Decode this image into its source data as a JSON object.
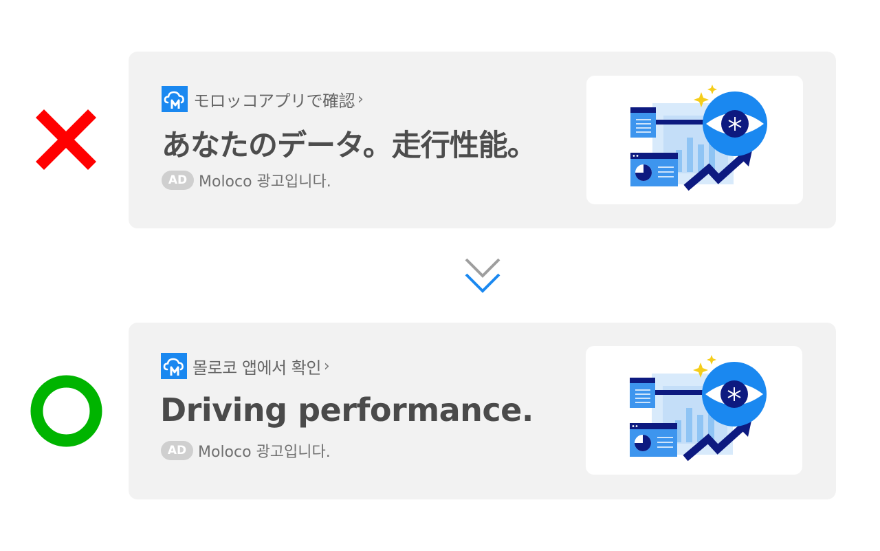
{
  "examples": {
    "bad": {
      "verdict_icon": "cross-icon",
      "verdict_color": "#ff0000",
      "source_text": "モロッコアプリで確認",
      "headline": "あなたのデータ。走行性能。",
      "ad_badge": "AD",
      "ad_text": "Moloco 광고입니다."
    },
    "good": {
      "verdict_icon": "circle-icon",
      "verdict_color": "#00b400",
      "source_text": "몰로코 앱에서 확인",
      "headline": "Driving performance.",
      "ad_badge": "AD",
      "ad_text": "Moloco 광고입니다."
    }
  },
  "source_chevron": "›",
  "icons": {
    "app_logo": "moloco-cloud-m-logo",
    "hero": "analytics-eye-illustration",
    "transition": "double-chevron-down-icon"
  },
  "colors": {
    "card_bg": "#f2f2f2",
    "brand_blue": "#1a88f0",
    "navy": "#0d1a80",
    "light_blue": "#8fc4f4",
    "sparkle": "#f5cd1a",
    "chevron_gray": "#9e9e9e",
    "chevron_blue": "#1a88f0"
  }
}
